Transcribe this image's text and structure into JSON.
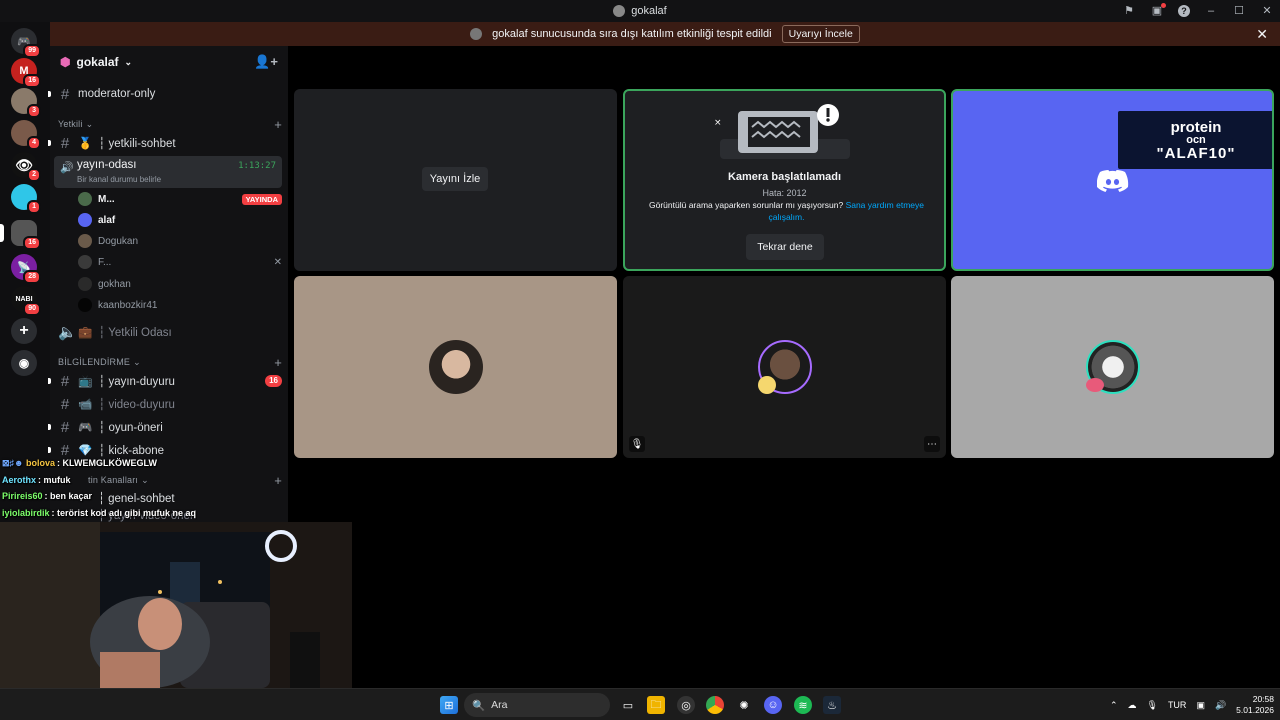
{
  "titlebar": {
    "title": "gokalaf"
  },
  "banner": {
    "message": "gokalaf sunucusunda sıra dışı katılım etkinliği tespit edildi",
    "button": "Uyarıyı İncele"
  },
  "rail": {
    "badges": [
      "99",
      "16",
      "3",
      "4",
      "2",
      "1",
      "16",
      "28",
      "90"
    ],
    "label_nabi": "NABI"
  },
  "server": {
    "name": "gokalaf"
  },
  "channels": {
    "moderator": "moderator-only",
    "cat_yetkili": "Yetkili",
    "yetkili_sohbet": "┆ yetkili-sohbet",
    "voice_name": "yayın-odası",
    "voice_sub": "Bir kanal durumu belirle",
    "voice_time": "1:13:27",
    "users": [
      "M...",
      "alaf",
      "Dogukan",
      "F...",
      "gokhan",
      "kaanbozkir41"
    ],
    "live_label": "YAYINDA",
    "yetkili_odasi": "┆ Yetkili Odası",
    "cat_bilgi": "BİLGİLENDİRME",
    "yayin_duyuru": "┆ yayın-duyuru",
    "yayin_duyuru_count": "16",
    "video_duyuru": "┆ video-duyuru",
    "oyun_oneri": "┆ oyun-öneri",
    "kick_abone": "┆ kick-abone",
    "cat_metin": "tin Kanalları",
    "genel_sohbet": "┆ genel-sohbet",
    "yayin_video": "┆ yayın-video-öneri"
  },
  "tiles": {
    "watch": "Yayını İzle",
    "cam_title": "Kamera başlatılamadı",
    "cam_error": "Hata: 2012",
    "cam_msg": "Görüntülü arama yaparken sorunlar mı yaşıyorsun?",
    "cam_link": "Sana yardım etmeye çalışalım.",
    "retry": "Tekrar dene",
    "promo_1": "protein",
    "promo_2": "ocn",
    "promo_3": "\"ALAF10\""
  },
  "chat": [
    {
      "user": "bolova",
      "color": "#f5c542",
      "text": ": KLWEMGLKÖWEGLW"
    },
    {
      "user": "Aerothx",
      "color": "#6fe3ff",
      "text": ": mufuk"
    },
    {
      "user": "Pirireis60",
      "color": "#7dff6b",
      "text": ": ben kaçar"
    },
    {
      "user": "iyiolabirdik",
      "color": "#7dff6b",
      "text": ": terörist kod adı gibi mufuk ne aq"
    }
  ],
  "taskbar": {
    "search": "Ara",
    "lang": "TUR",
    "time": "20:58",
    "date": "5.01.2026"
  }
}
